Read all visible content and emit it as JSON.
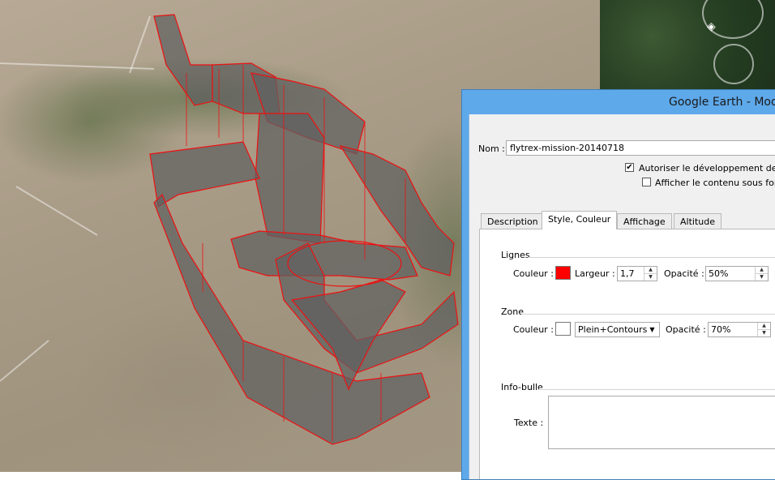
{
  "window": {
    "title": "Google Earth - Mod"
  },
  "form": {
    "name_label": "Nom :",
    "name_value": "flytrex-mission-20140718",
    "allow_expand": {
      "label": "Autoriser le développement de ce d",
      "checked": true
    },
    "show_as": {
      "label": "Afficher le contenu sous forme",
      "checked": false
    }
  },
  "tabs": [
    {
      "label": "Description",
      "active": false
    },
    {
      "label": "Style, Couleur",
      "active": true
    },
    {
      "label": "Affichage",
      "active": false
    },
    {
      "label": "Altitude",
      "active": false
    }
  ],
  "lines": {
    "group_label": "Lignes",
    "color_label": "Couleur :",
    "color": "#ff0000",
    "width_label": "Largeur :",
    "width_value": "1,7",
    "opacity_label": "Opacité :",
    "opacity_value": "50%"
  },
  "zone": {
    "group_label": "Zone",
    "color_label": "Couleur :",
    "color": "#ffffff",
    "mode_value": "Plein+Contours",
    "opacity_label": "Opacité :",
    "opacity_value": "70%"
  },
  "infobulle": {
    "group_label": "Info-bulle",
    "text_label": "Texte :",
    "text_value": ""
  },
  "icons": {
    "check": "✔",
    "spin_up": "▲",
    "spin_down": "▼",
    "combo_arrow": "▼",
    "nav": "◈"
  },
  "colors": {
    "title_bar": "#5ea9ea",
    "path_stroke": "#e02020",
    "path_fill": "#6b6b6b"
  }
}
